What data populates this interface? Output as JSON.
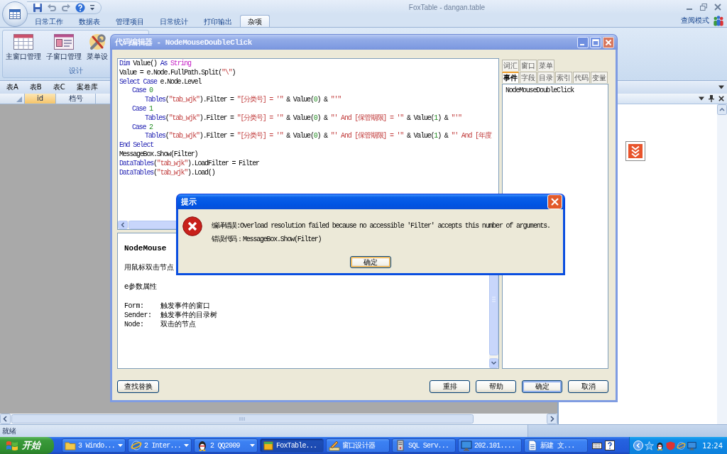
{
  "app_window": {
    "title": "FoxTable - dangan.table",
    "ribbon_tabs": [
      {
        "label": "日常工作",
        "selected": false
      },
      {
        "label": "数据表",
        "selected": false
      },
      {
        "label": "管理项目",
        "selected": false
      },
      {
        "label": "日常统计",
        "selected": false
      },
      {
        "label": "打印输出",
        "selected": false
      },
      {
        "label": "杂项",
        "selected": true
      }
    ],
    "mode_label": "查阅模式",
    "ribbon_group": {
      "label": "设计",
      "buttons": [
        "主窗口管理",
        "子窗口管理",
        "菜单设"
      ]
    },
    "table_tabs": [
      "表A",
      "表B",
      "表C",
      "案卷库"
    ],
    "grid_columns": [
      {
        "label": "id",
        "selected": true
      },
      {
        "label": "档号",
        "selected": false
      }
    ],
    "status_bar": {
      "text": "就绪"
    }
  },
  "code_editor": {
    "title": "代码编辑器 - NodeMouseDoubleClick",
    "code_lines": [
      {
        "tokens": [
          {
            "kind": "keyword",
            "text": "Dim"
          },
          {
            "kind": "plain",
            "text": " Value() "
          },
          {
            "kind": "keyword",
            "text": "As"
          },
          {
            "kind": "type",
            "text": " String"
          }
        ]
      },
      {
        "tokens": [
          {
            "kind": "plain",
            "text": "Value = e.Node.FullPath.Split("
          },
          {
            "kind": "string",
            "text": "\"\\\""
          },
          {
            "kind": "plain",
            "text": ")"
          }
        ]
      },
      {
        "tokens": [
          {
            "kind": "keyword",
            "text": "Select Case"
          },
          {
            "kind": "plain",
            "text": " e.Node.Level"
          }
        ],
        "children": [
          {
            "tokens": [
              {
                "kind": "keyword",
                "text": "Case"
              },
              {
                "kind": "number",
                "text": " 0"
              }
            ],
            "children": [
              {
                "tokens": [
                  {
                    "kind": "keyword",
                    "text": "Tables"
                  },
                  {
                    "kind": "plain",
                    "text": "("
                  },
                  {
                    "kind": "string",
                    "text": "\"tab_wjk\""
                  },
                  {
                    "kind": "plain",
                    "text": ").Filter = "
                  },
                  {
                    "kind": "string",
                    "text": "\"[分类号] = '\""
                  },
                  {
                    "kind": "plain",
                    "text": " & Value("
                  },
                  {
                    "kind": "number",
                    "text": "0"
                  },
                  {
                    "kind": "plain",
                    "text": ") & "
                  },
                  {
                    "kind": "string",
                    "text": "\"'\""
                  }
                ]
              }
            ]
          },
          {
            "tokens": [
              {
                "kind": "keyword",
                "text": "Case"
              },
              {
                "kind": "number",
                "text": " 1"
              }
            ],
            "children": [
              {
                "tokens": [
                  {
                    "kind": "keyword",
                    "text": "Tables"
                  },
                  {
                    "kind": "plain",
                    "text": "("
                  },
                  {
                    "kind": "string",
                    "text": "\"tab_wjk\""
                  },
                  {
                    "kind": "plain",
                    "text": ").Filter = "
                  },
                  {
                    "kind": "string",
                    "text": "\"[分类号] = '\""
                  },
                  {
                    "kind": "plain",
                    "text": " & Value("
                  },
                  {
                    "kind": "number",
                    "text": "0"
                  },
                  {
                    "kind": "plain",
                    "text": ") & "
                  },
                  {
                    "kind": "string",
                    "text": "\"' And [保管期限] = '\""
                  },
                  {
                    "kind": "plain",
                    "text": " & Value("
                  },
                  {
                    "kind": "number",
                    "text": "1"
                  },
                  {
                    "kind": "plain",
                    "text": ") & "
                  },
                  {
                    "kind": "string",
                    "text": "\"'\""
                  }
                ]
              }
            ]
          },
          {
            "tokens": [
              {
                "kind": "keyword",
                "text": "Case"
              },
              {
                "kind": "number",
                "text": " 2"
              }
            ],
            "children": [
              {
                "tokens": [
                  {
                    "kind": "keyword",
                    "text": "Tables"
                  },
                  {
                    "kind": "plain",
                    "text": "("
                  },
                  {
                    "kind": "string",
                    "text": "\"tab_wjk\""
                  },
                  {
                    "kind": "plain",
                    "text": ").Filter = "
                  },
                  {
                    "kind": "string",
                    "text": "\"[分类号] = '\""
                  },
                  {
                    "kind": "plain",
                    "text": " & Value("
                  },
                  {
                    "kind": "number",
                    "text": "0"
                  },
                  {
                    "kind": "plain",
                    "text": ") & "
                  },
                  {
                    "kind": "string",
                    "text": "\"' And [保管期限] = '\""
                  },
                  {
                    "kind": "plain",
                    "text": " & Value("
                  },
                  {
                    "kind": "number",
                    "text": "1"
                  },
                  {
                    "kind": "plain",
                    "text": ") & "
                  },
                  {
                    "kind": "string",
                    "text": "\"' And [年度"
                  }
                ]
              }
            ]
          }
        ]
      },
      {
        "tokens": [
          {
            "kind": "keyword",
            "text": "End Select"
          }
        ]
      },
      {
        "tokens": [
          {
            "kind": "plain",
            "text": "MessageBox.Show(Filter)"
          }
        ]
      },
      {
        "tokens": [
          {
            "kind": "keyword",
            "text": "DataTables"
          },
          {
            "kind": "plain",
            "text": "("
          },
          {
            "kind": "string",
            "text": "\"tab_wjk\""
          },
          {
            "kind": "plain",
            "text": ").LoadFilter = Filter"
          }
        ]
      },
      {
        "tokens": [
          {
            "kind": "keyword",
            "text": "DataTables"
          },
          {
            "kind": "plain",
            "text": "("
          },
          {
            "kind": "string",
            "text": "\"tab_wjk\""
          },
          {
            "kind": "plain",
            "text": ").Load()"
          }
        ]
      }
    ],
    "help": {
      "heading": "NodeMouse",
      "summary": "用鼠标双击节点",
      "section": "e参数属性",
      "params": [
        {
          "name": "Form:",
          "description": "触发事件的窗口"
        },
        {
          "name": "Sender:",
          "description": "触发事件的目录树"
        },
        {
          "name": "Node:",
          "description": "双击的节点"
        }
      ]
    },
    "tab_rows": [
      {
        "tabs": [
          {
            "label": "词汇",
            "selected": false
          },
          {
            "label": "窗口",
            "selected": false
          },
          {
            "label": "菜单",
            "selected": false
          }
        ]
      },
      {
        "tabs": [
          {
            "label": "事件",
            "selected": true
          },
          {
            "label": "字段",
            "selected": false
          },
          {
            "label": "目录",
            "selected": false
          },
          {
            "label": "索引",
            "selected": false
          },
          {
            "label": "代码",
            "selected": false
          },
          {
            "label": "变量",
            "selected": false
          }
        ]
      }
    ],
    "event_list": [
      "NodeMouseDoubleClick"
    ],
    "tool_button": "查找替换",
    "buttons": [
      {
        "label": "重排",
        "default": false
      },
      {
        "label": "帮助",
        "default": false
      },
      {
        "label": "确定",
        "default": true
      },
      {
        "label": "取消",
        "default": false
      }
    ]
  },
  "dialog": {
    "title": "提示",
    "message": "编译错误:Overload resolution failed because no accessible 'Filter' accepts this number of arguments.",
    "detail": "错误代码：MessageBox.Show(Filter)",
    "button": "确定"
  },
  "taskbar": {
    "start_label": "开始",
    "tasks": [
      {
        "label": "3 Windo...",
        "grouped": true,
        "selected": false
      },
      {
        "label": "2 Inter...",
        "grouped": true,
        "selected": false
      },
      {
        "label": "2 QQ2009",
        "grouped": true,
        "selected": false
      },
      {
        "label": "FoxTable...",
        "grouped": false,
        "selected": true
      },
      {
        "label": "窗口设计器",
        "grouped": false,
        "selected": false
      },
      {
        "label": "SQL Serv...",
        "grouped": false,
        "selected": false
      },
      {
        "label": "202.101....",
        "grouped": false,
        "selected": false
      },
      {
        "label": "新建 文...",
        "grouped": false,
        "selected": false
      }
    ],
    "clock": "12:24"
  }
}
